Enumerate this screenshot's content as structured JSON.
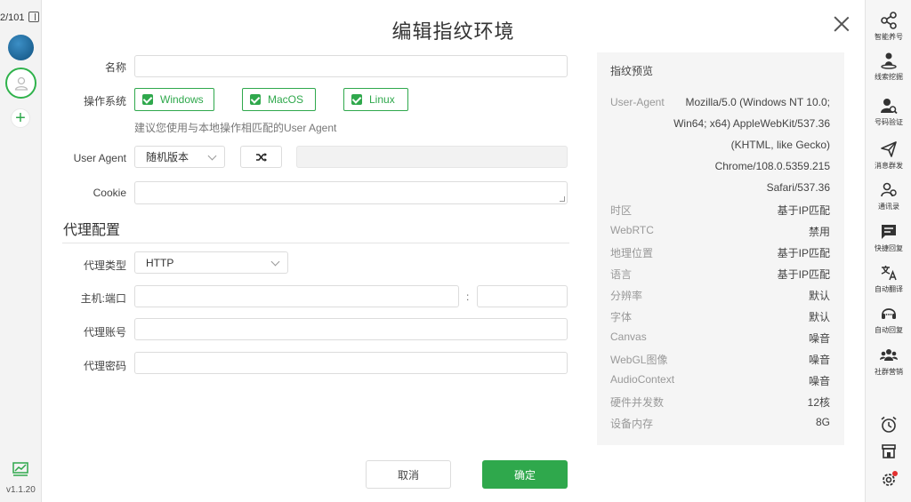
{
  "left_rail": {
    "counter": "2/101",
    "version": "v1.1.20"
  },
  "dialog": {
    "title": "编辑指纹环境",
    "fields": {
      "name_label": "名称",
      "name_value": "",
      "os_label": "操作系统",
      "os_options": [
        "Windows",
        "MacOS",
        "Linux"
      ],
      "os_hint": "建议您使用与本地操作相匹配的User Agent",
      "ua_label": "User Agent",
      "ua_mode": "随机版本",
      "ua_value": "",
      "cookie_label": "Cookie",
      "cookie_value": ""
    },
    "proxy": {
      "section_title": "代理配置",
      "type_label": "代理类型",
      "type_value": "HTTP",
      "host_label": "主机:端口",
      "host_value": "",
      "port_separator": ":",
      "port_value": "",
      "account_label": "代理账号",
      "account_value": "",
      "password_label": "代理密码",
      "password_value": ""
    },
    "buttons": {
      "cancel": "取消",
      "confirm": "确定"
    },
    "preview": {
      "title": "指纹预览",
      "ua_key": "User-Agent",
      "ua_lines": [
        "Mozilla/5.0 (Windows NT 10.0;",
        "Win64; x64) AppleWebKit/537.36",
        "(KHTML, like Gecko)",
        "Chrome/108.0.5359.215",
        "Safari/537.36"
      ],
      "rows": [
        {
          "key": "时区",
          "value": "基于IP匹配"
        },
        {
          "key": "WebRTC",
          "value": "禁用"
        },
        {
          "key": "地理位置",
          "value": "基于IP匹配"
        },
        {
          "key": "语言",
          "value": "基于IP匹配"
        },
        {
          "key": "分辨率",
          "value": "默认"
        },
        {
          "key": "字体",
          "value": "默认"
        },
        {
          "key": "Canvas",
          "value": "噪音"
        },
        {
          "key": "WebGL图像",
          "value": "噪音"
        },
        {
          "key": "AudioContext",
          "value": "噪音"
        },
        {
          "key": "硬件并发数",
          "value": "12核"
        },
        {
          "key": "设备内存",
          "value": "8G"
        }
      ]
    }
  },
  "right_rail": {
    "items": [
      {
        "label": "智能养号",
        "icon": "share-icon"
      },
      {
        "label": "线索挖掘",
        "icon": "map-pin-user-icon"
      },
      {
        "label": "号码验证",
        "icon": "user-search-icon"
      },
      {
        "label": "消息群发",
        "icon": "send-icon"
      },
      {
        "label": "通讯录",
        "icon": "contacts-icon"
      },
      {
        "label": "快捷回复",
        "icon": "chat-icon"
      },
      {
        "label": "自动翻译",
        "icon": "translate-icon"
      },
      {
        "label": "自动回复",
        "icon": "headset-icon"
      },
      {
        "label": "社群营销",
        "icon": "group-icon"
      }
    ],
    "bottom_icons": [
      "alarm-icon",
      "store-icon",
      "settings-icon"
    ]
  },
  "colors": {
    "accent": "#2fa84c",
    "notification": "#e23030"
  }
}
